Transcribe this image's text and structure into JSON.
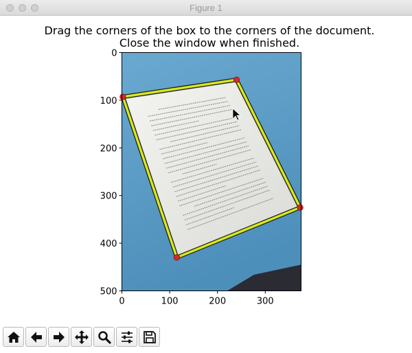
{
  "window": {
    "title": "Figure 1"
  },
  "figure": {
    "title_line1": "Drag the corners of the box to the corners of the document.",
    "title_line2": "Close the window when finished."
  },
  "chart_data": {
    "type": "image",
    "x_ticks": [
      "0",
      "100",
      "200",
      "300"
    ],
    "y_ticks": [
      "0",
      "100",
      "200",
      "300",
      "400",
      "500"
    ],
    "xlim": [
      0,
      375
    ],
    "ylim": [
      500,
      0
    ],
    "corners": [
      {
        "x": 240,
        "y": 57
      },
      {
        "x": 373,
        "y": 325
      },
      {
        "x": 115,
        "y": 430
      },
      {
        "x": 2,
        "y": 93
      }
    ],
    "box_color": "#d6e81e",
    "corner_color": "#d42a2a",
    "background_color": "#5f9fc7",
    "paper_color": "#f2f2ee"
  },
  "toolbar": {
    "buttons": [
      {
        "name": "home-icon"
      },
      {
        "name": "back-arrow-icon"
      },
      {
        "name": "forward-arrow-icon"
      },
      {
        "name": "pan-icon"
      },
      {
        "name": "zoom-icon"
      },
      {
        "name": "subplots-config-icon"
      },
      {
        "name": "save-icon"
      }
    ]
  }
}
